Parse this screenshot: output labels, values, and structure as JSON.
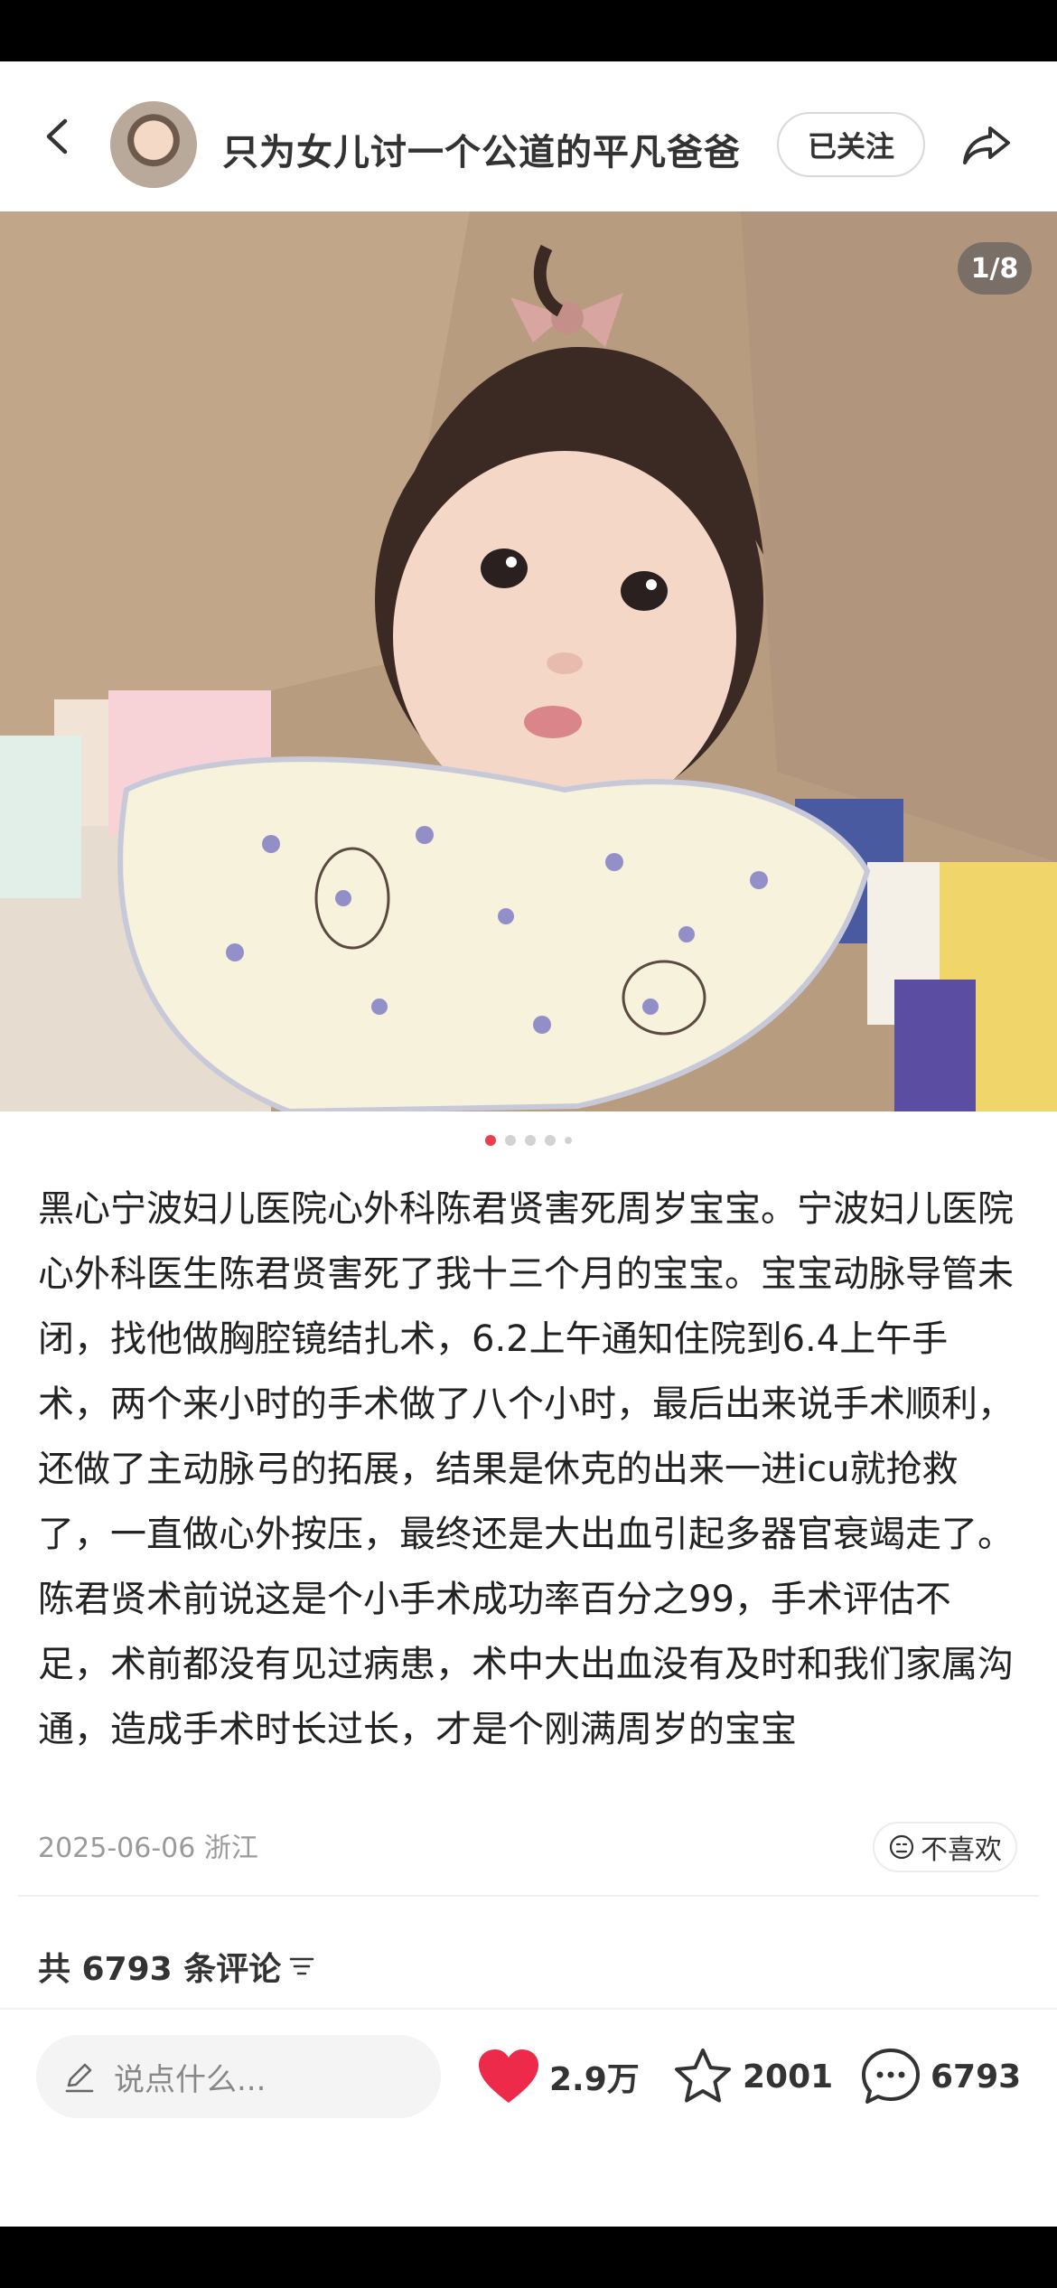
{
  "header": {
    "username": "只为女儿讨一个公道的平凡爸爸",
    "follow_label": "已关注"
  },
  "photo": {
    "counter": "1/8",
    "dots": 5,
    "active_dot": 0
  },
  "post": {
    "text": "黑心宁波妇儿医院心外科陈君贤害死周岁宝宝。宁波妇儿医院心外科医生陈君贤害死了我十三个月的宝宝。宝宝动脉导管未闭，找他做胸腔镜结扎术，6.2上午通知住院到6.4上午手术，两个来小时的手术做了八个小时，最后出来说手术顺利，还做了主动脉弓的拓展，结果是休克的出来一进icu就抢救了，一直做心外按压，最终还是大出血引起多器官衰竭走了。陈君贤术前说这是个小手术成功率百分之99，手术评估不足，术前都没有见过病患，术中大出血没有及时和我们家属沟通，造成手术时长过长，才是个刚满周岁的宝宝",
    "date_location": "2025-06-06 浙江",
    "dislike_label": "不喜欢"
  },
  "comments": {
    "count_label": "共 6793 条评论"
  },
  "actions": {
    "input_placeholder": "说点什么...",
    "likes": "2.9万",
    "favorites": "2001",
    "comments": "6793",
    "like_color": "#ee2a4a"
  }
}
